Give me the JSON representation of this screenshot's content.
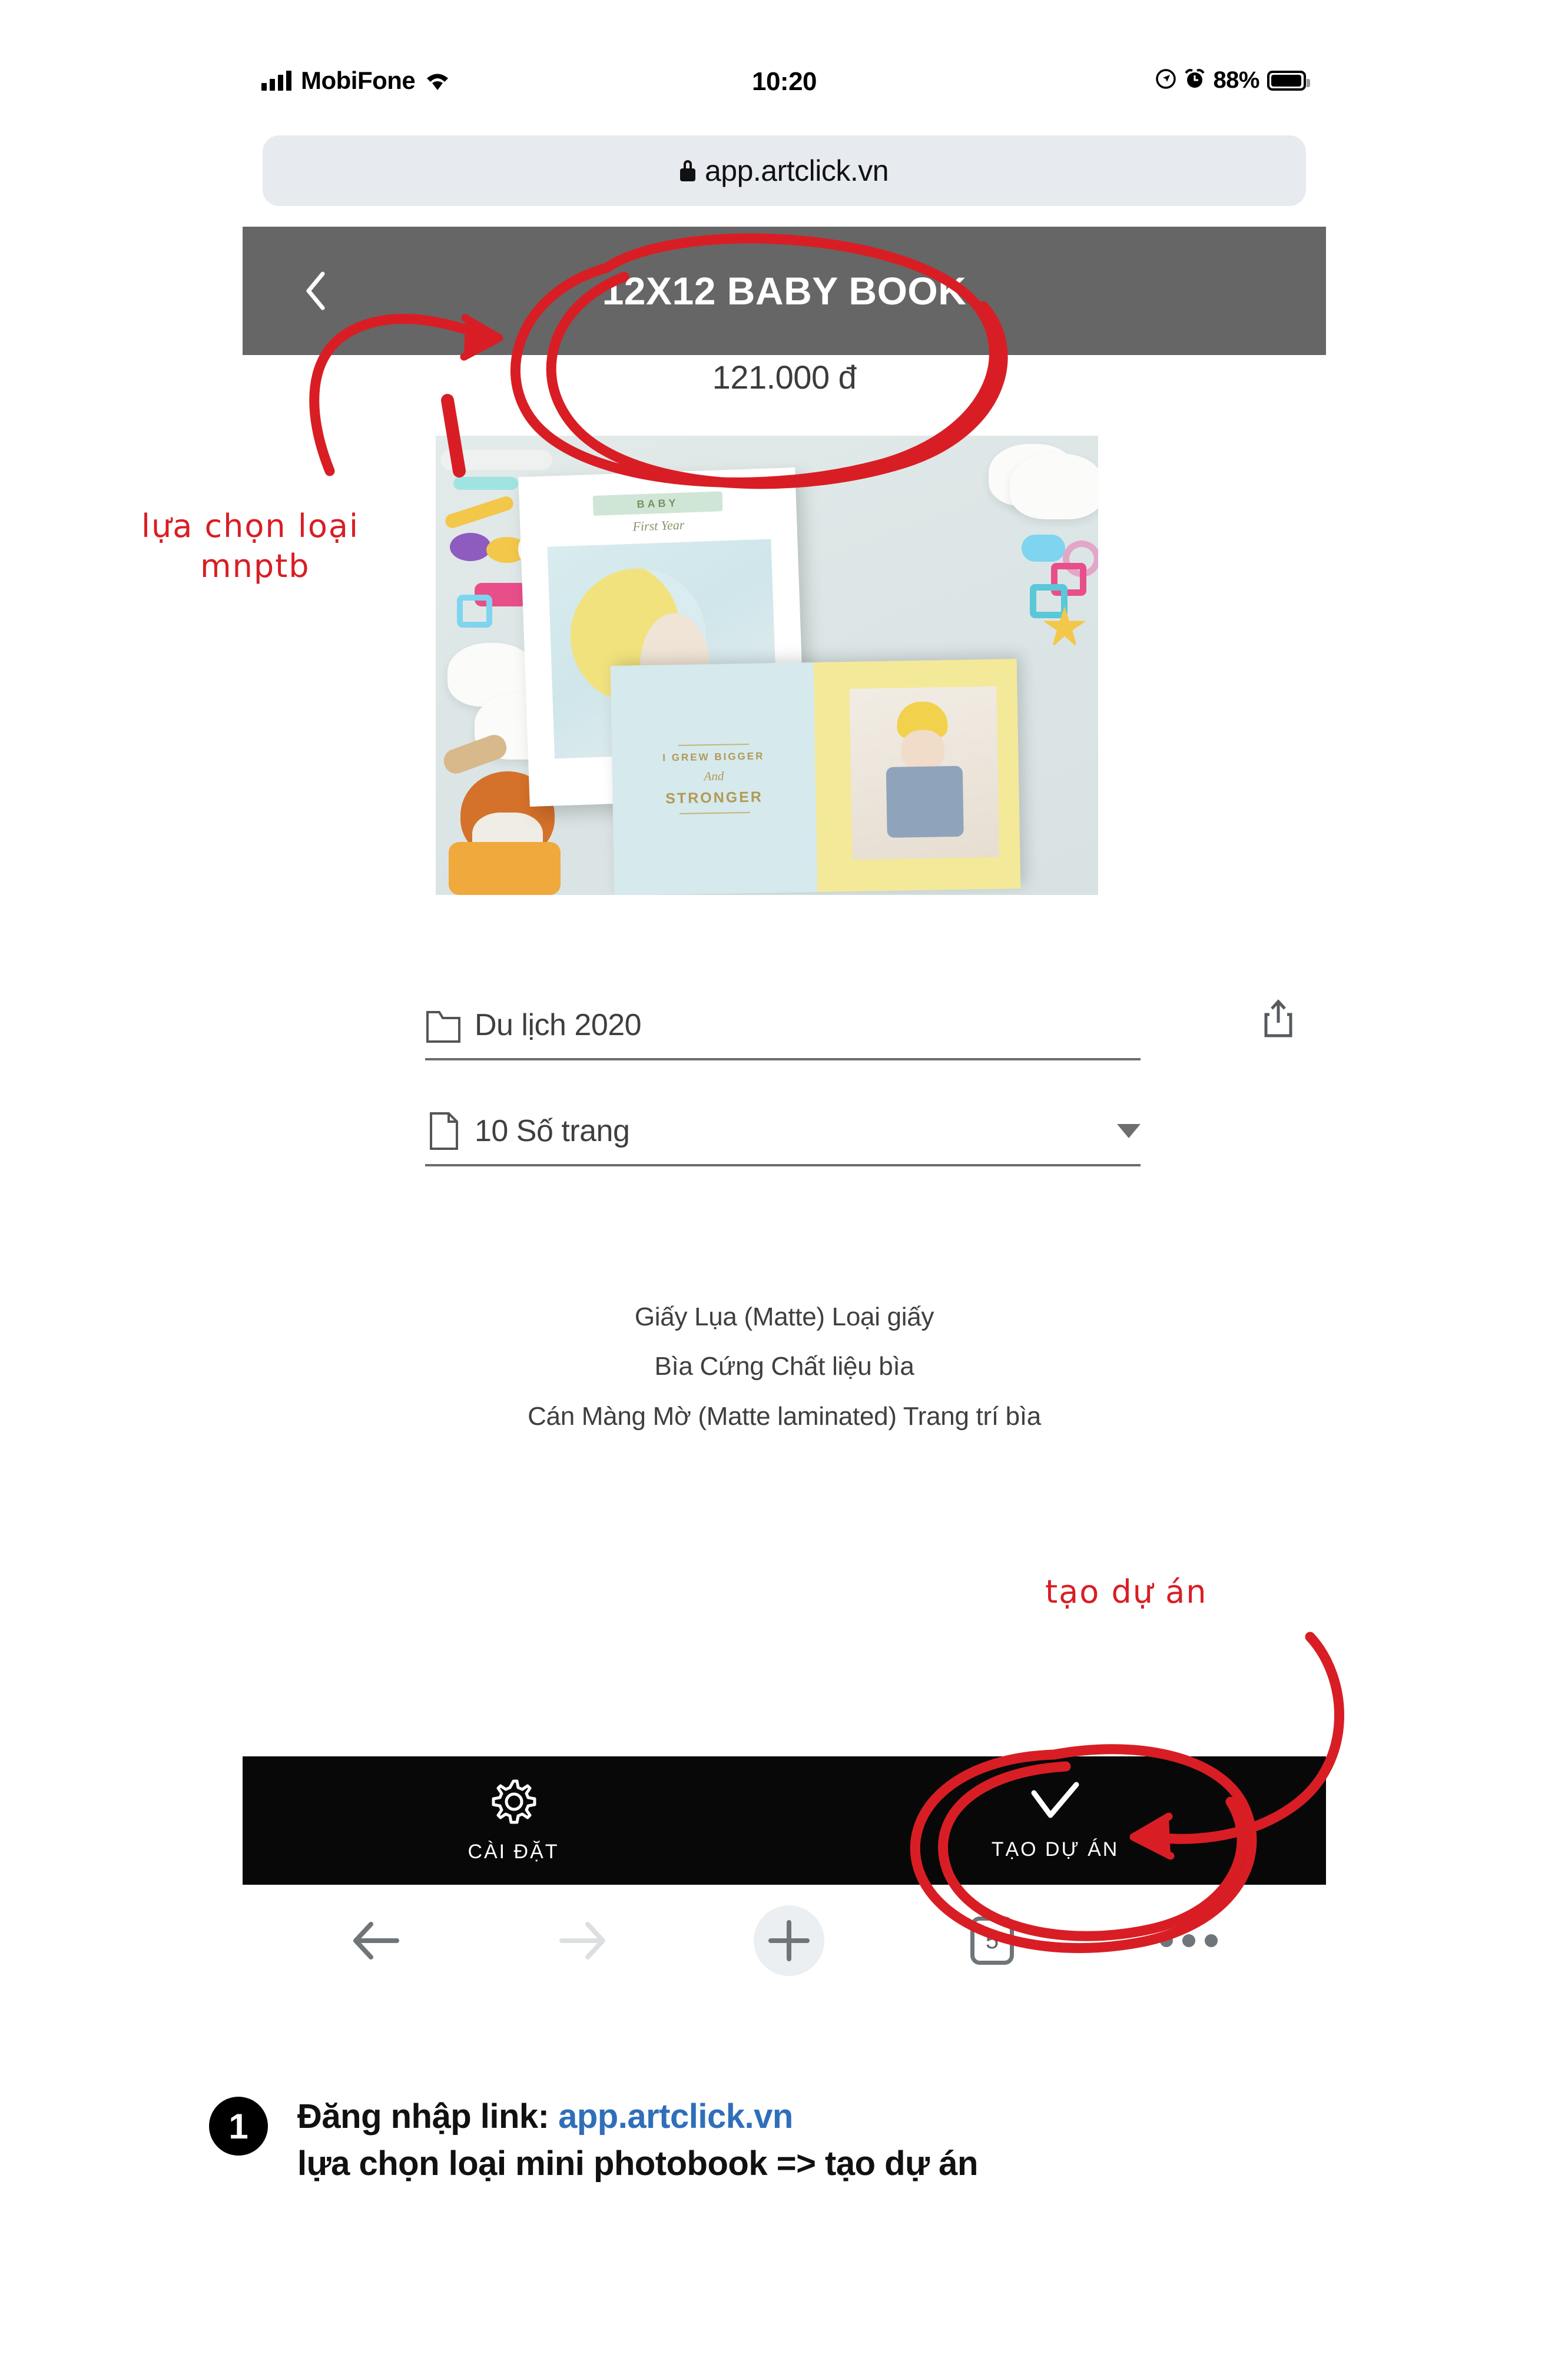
{
  "statusbar": {
    "carrier": "MobiFone",
    "time": "10:20",
    "battery_percent": "88%",
    "signal_icon": "cellular-bars-icon",
    "wifi_icon": "wifi-icon",
    "location_icon": "location-arrow-icon",
    "alarm_icon": "alarm-clock-icon",
    "battery_icon": "battery-icon"
  },
  "browser": {
    "url": "app.artclick.vn",
    "lock_icon": "lock-icon",
    "share_icon": "share-icon",
    "toolbar": {
      "back_icon": "back-arrow-icon",
      "forward_icon": "forward-arrow-icon",
      "new_tab_icon": "plus-icon",
      "tabs_count": "5",
      "more_icon": "more-dots-icon"
    }
  },
  "app": {
    "header": {
      "back_icon": "chevron-left-icon",
      "title": "12X12 BABY BOOK"
    },
    "price": "121.000 đ",
    "hero_image": {
      "name": "baby-photobook-hero-image",
      "book_cover_title": "BABY",
      "book_cover_subtitle": "First Year",
      "spread_line1": "I GREW BIGGER",
      "spread_line2": "And",
      "spread_line3": "STRONGER"
    },
    "fields": [
      {
        "icon": "folder-icon",
        "value": "Du lịch 2020",
        "name": "project-folder-field",
        "has_caret": false
      },
      {
        "icon": "page-icon",
        "value": "10 Số trang",
        "name": "page-count-select",
        "has_caret": true
      }
    ],
    "specs": [
      "Giấy Lụa (Matte) Loại giấy",
      "Bìa Cứng Chất liệu bìa",
      "Cán Màng Mờ (Matte laminated) Trang trí bìa"
    ],
    "bottom_bar": [
      {
        "icon": "gear-icon",
        "label": "CÀI ĐẶT",
        "name": "settings-button"
      },
      {
        "icon": "check-icon",
        "label": "TẠO DỰ ÁN",
        "name": "create-project-button"
      }
    ]
  },
  "annotations": {
    "ink_color": "#d81e24",
    "left_note_line1": "lựa chọn loại",
    "left_note_line2": "mnptb",
    "right_note": "tạo dự án"
  },
  "caption": {
    "badge": "1",
    "line1_prefix": "Đăng nhập link: ",
    "line1_link": "app.artclick.vn",
    "line2": "lựa chọn loại mini photobook => tạo dự án",
    "link_color": "#2f6fba"
  }
}
